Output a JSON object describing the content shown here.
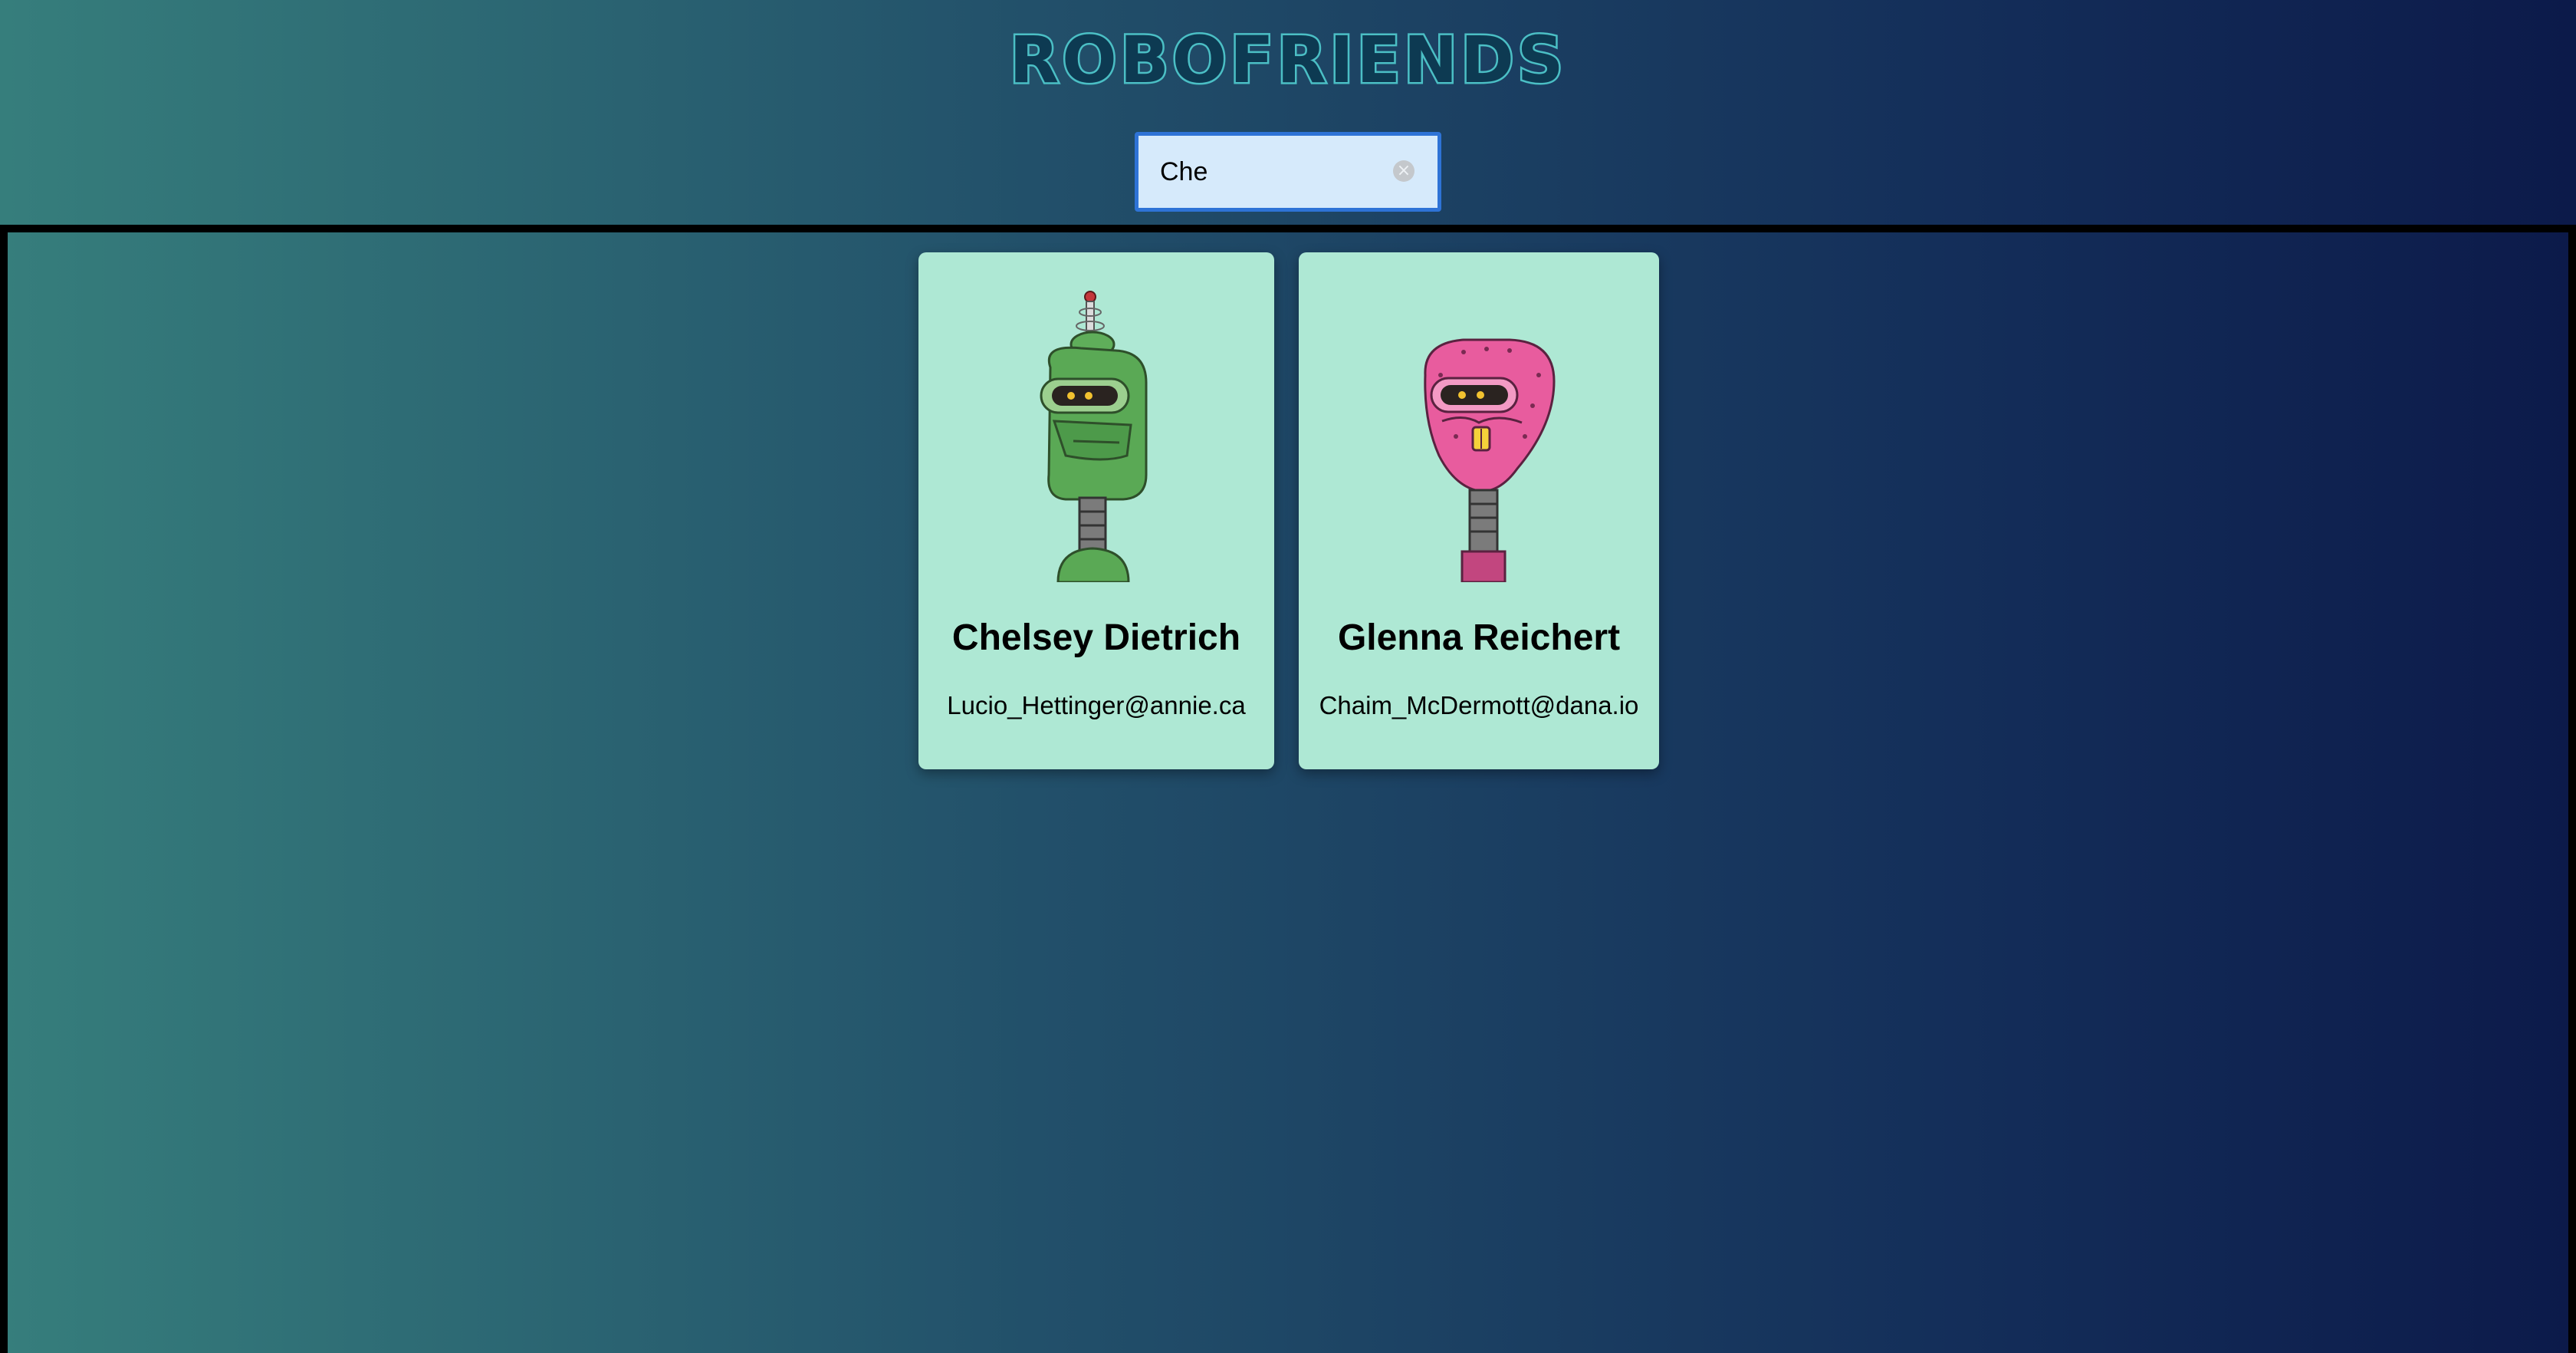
{
  "app": {
    "title": "ROBOFRIENDS"
  },
  "search": {
    "value": "Che",
    "clear_icon": "clear-circle-icon"
  },
  "robots": [
    {
      "name": "Chelsey Dietrich",
      "email": "Lucio_Hettinger@annie.ca",
      "avatar": "green-robot-avatar"
    },
    {
      "name": "Glenna Reichert",
      "email": "Chaim_McDermott@dana.io",
      "avatar": "pink-robot-avatar"
    }
  ],
  "colors": {
    "title_stroke": "#4bbfc5",
    "card_background": "#aee8d4",
    "search_border": "#2e73d6",
    "search_background": "#d6eafb"
  }
}
